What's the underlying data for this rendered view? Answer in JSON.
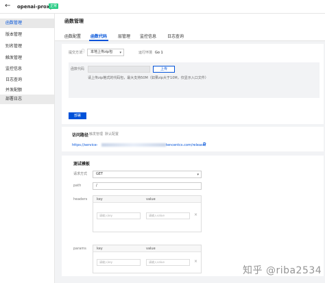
{
  "app": {
    "title": "openai-proxy",
    "status": "正常",
    "status_color": "#29cc85",
    "back_icon": "arrow-left-icon"
  },
  "sidebar": {
    "items": [
      {
        "label": "函数管理",
        "active": true
      },
      {
        "label": "版本管理"
      },
      {
        "label": "别名管理"
      },
      {
        "label": "触发管理"
      },
      {
        "label": "监控信息"
      },
      {
        "label": "日志查询"
      },
      {
        "label": "并发配额"
      },
      {
        "label": "部署日志",
        "selected": true
      }
    ]
  },
  "page": {
    "title": "函数管理",
    "tabs": [
      "函数配置",
      "函数代码",
      "层管理",
      "监控信息",
      "日志查询"
    ],
    "active_tab": "函数代码"
  },
  "code": {
    "submit_label": "提交方法",
    "submit_value": "本地上传zip包",
    "runtime_label": "运行环境",
    "runtime_value": "Go 1",
    "package_label": "函数代码",
    "upload_button": "上传",
    "hint": "请上传zip格式的代码包，最大支持50M（如果zip大于10M，仅显示入口文件）",
    "deploy_button": "部署"
  },
  "access": {
    "title": "访问路径",
    "links": [
      "触发管理",
      "默认配置"
    ],
    "url_start": "https://service-",
    "url_end": "tencentcs.com/release/",
    "external_icon": "external-link-icon"
  },
  "test": {
    "title": "测试模板",
    "method_label": "请求方式",
    "method_value": "GET",
    "path_label": "path",
    "path_value": "/",
    "headers_label": "headers",
    "params_label": "params",
    "key_col": "key",
    "value_col": "value",
    "key_placeholder": "请输入key",
    "value_placeholder": "请输入value"
  },
  "watermark": "知乎 @riba2534"
}
